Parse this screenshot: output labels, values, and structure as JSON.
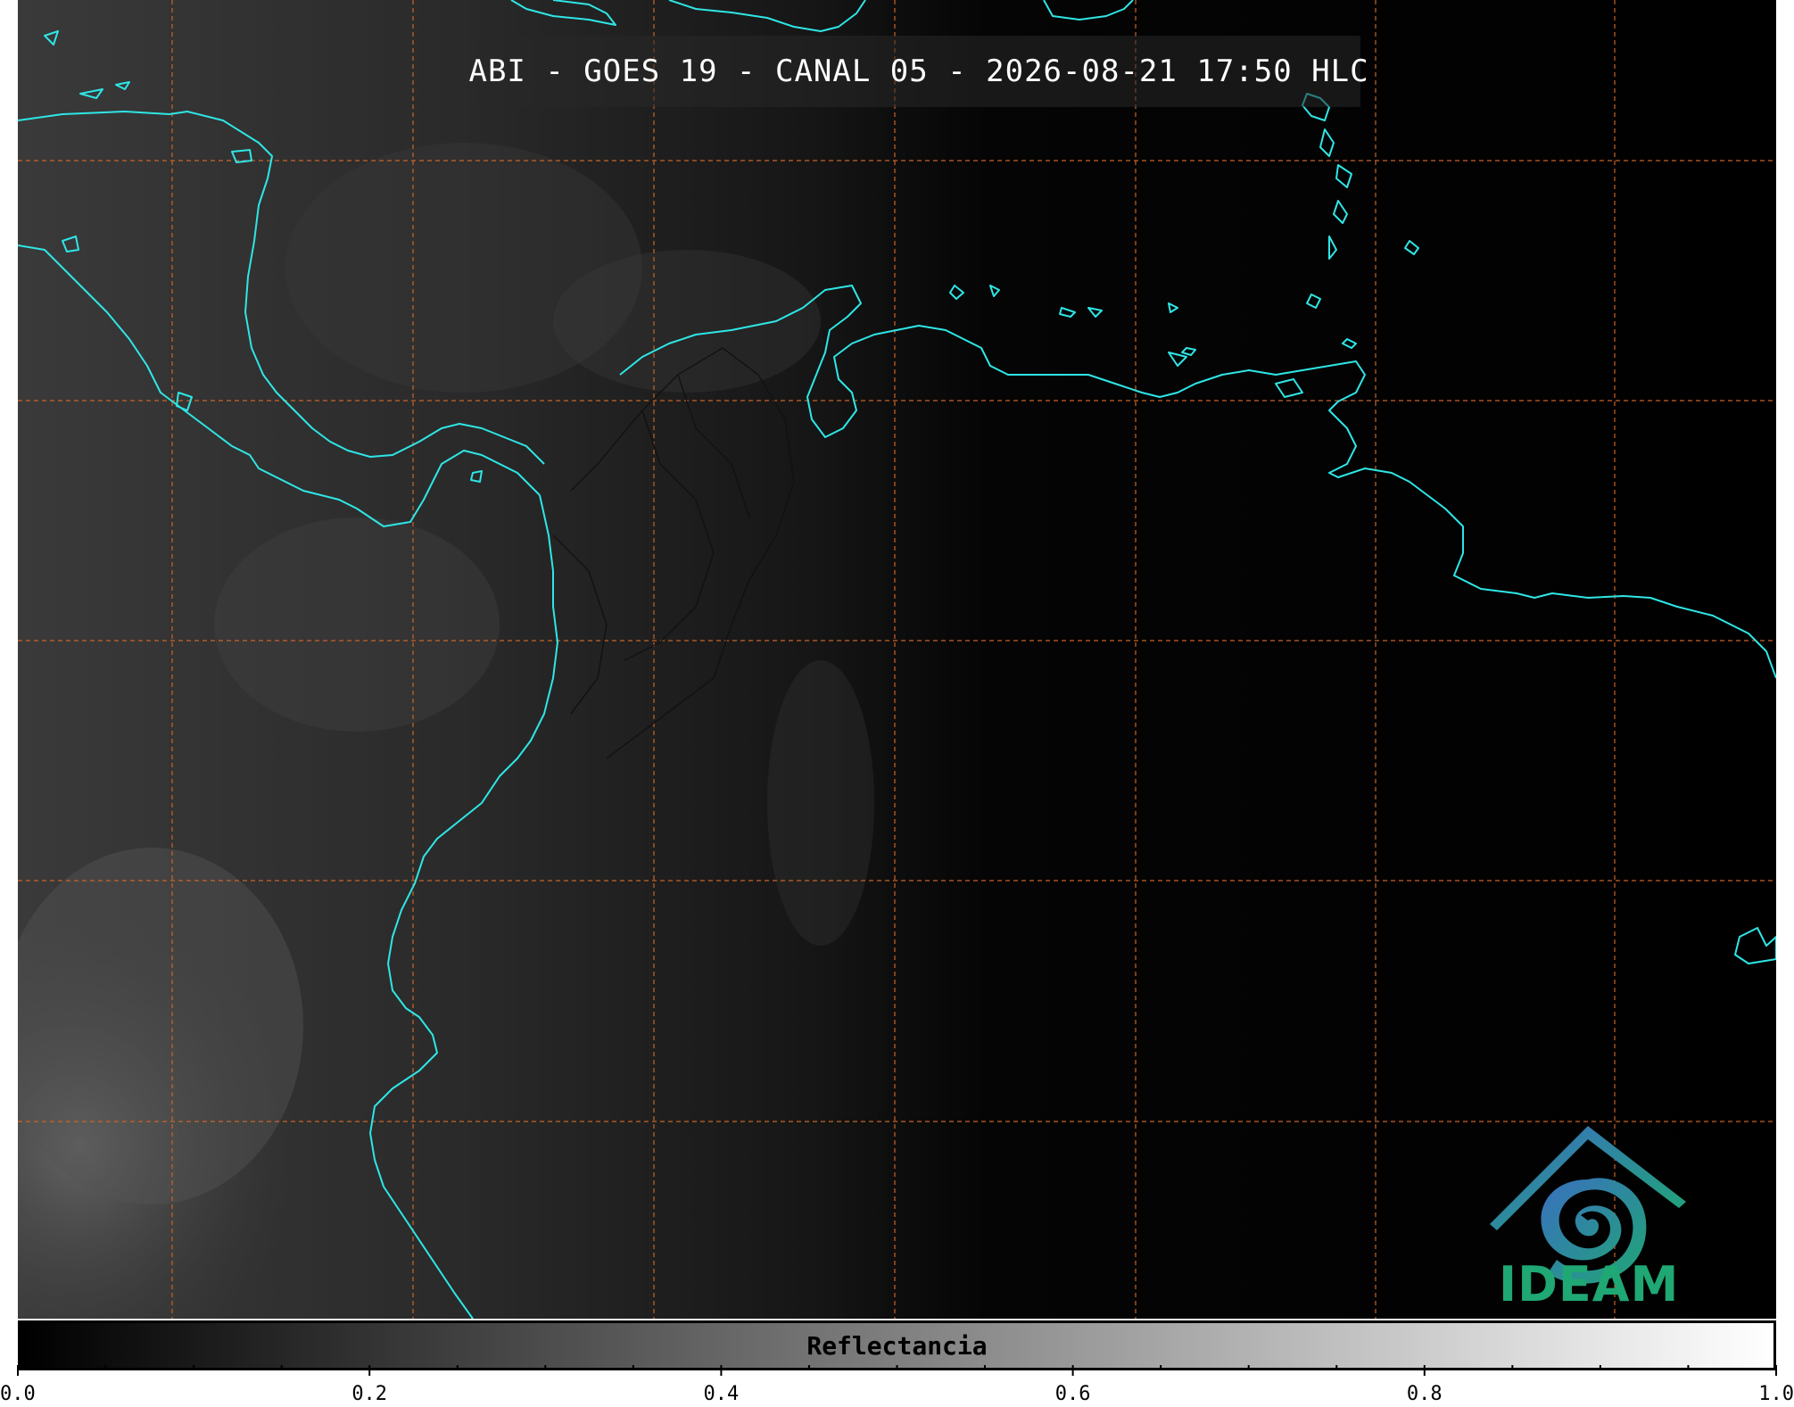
{
  "title": "ABI - GOES 19 - CANAL 05 - 2026-08-21 17:50 HLC",
  "logo_text": "IDEAM",
  "colorbar": {
    "label": "Reflectancia",
    "min": 0.0,
    "max": 1.0,
    "colors": [
      "#000000",
      "#ffffff"
    ],
    "major_ticks": [
      {
        "value": 0.0,
        "label": "0.0"
      },
      {
        "value": 0.2,
        "label": "0.2"
      },
      {
        "value": 0.4,
        "label": "0.4"
      },
      {
        "value": 0.6,
        "label": "0.6"
      },
      {
        "value": 0.8,
        "label": "0.8"
      },
      {
        "value": 1.0,
        "label": "1.0"
      }
    ],
    "minor_ticks": [
      0.05,
      0.1,
      0.15,
      0.25,
      0.3,
      0.35,
      0.45,
      0.5,
      0.55,
      0.65,
      0.7,
      0.75,
      0.85,
      0.9,
      0.95
    ]
  },
  "colors": {
    "coastline": "#2fe6e6",
    "gridline": "#c8642a",
    "borders": "#1a1a1a",
    "logo_gradient": [
      "#3a6fc0",
      "#1fa774"
    ]
  }
}
